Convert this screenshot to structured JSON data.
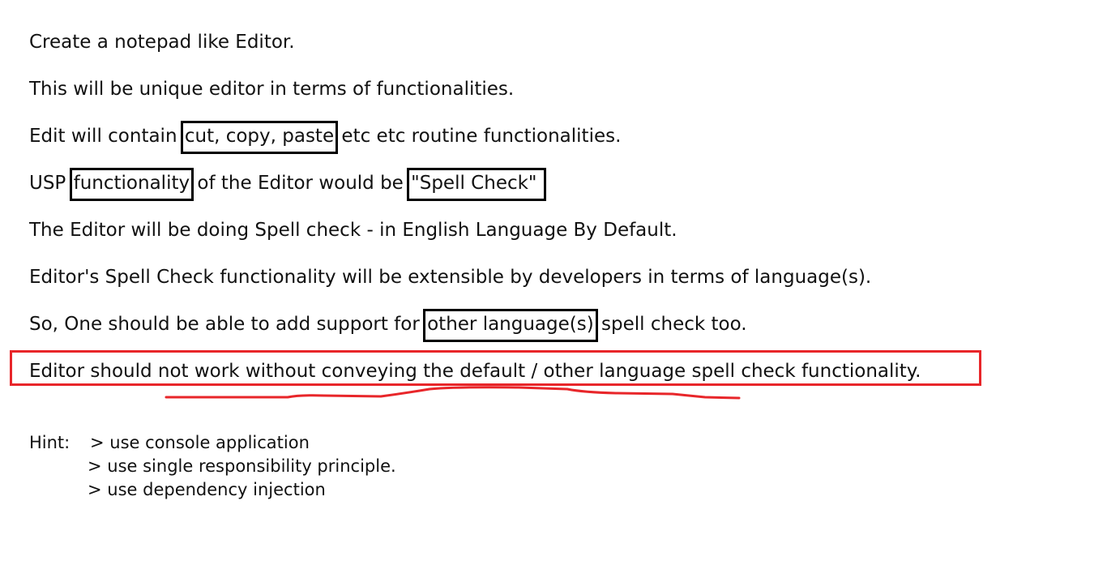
{
  "document": {
    "lines": [
      "Create a notepad like Editor.",
      "This will be unique editor in terms of functionalities."
    ],
    "edit_line": {
      "before": "Edit will contain ",
      "boxed": "cut, copy, paste",
      "after": " etc etc routine functionalities."
    },
    "usp_line": {
      "before": "USP ",
      "boxed1": "functionality",
      "middle": " of the Editor would be ",
      "boxed2": "\"Spell Check\""
    },
    "spell_default_line": "The Editor will be doing Spell check - in English Language By Default.",
    "extensible_line": "Editor's Spell Check functionality will be extensible by developers in terms of language(s).",
    "support_line": {
      "before": "So, One should be able to add support for ",
      "boxed": "other language(s)",
      "after": " spell check too."
    },
    "highlight_line": "Editor should not work without conveying the default / other language spell check functionality.",
    "hint": {
      "label": "Hint:",
      "items": [
        "> use console application",
        "> use single responsibility principle.",
        "> use dependency injection"
      ]
    },
    "colors": {
      "text": "#111111",
      "box": "#000000",
      "highlight": "#e8262a"
    }
  }
}
